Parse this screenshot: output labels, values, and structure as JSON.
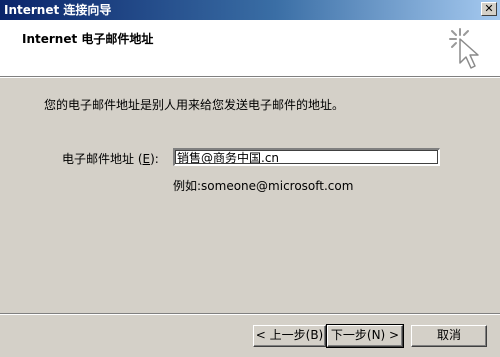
{
  "window": {
    "title": "Internet 连接向导",
    "close_glyph": "✕"
  },
  "header": {
    "title": "Internet 电子邮件地址",
    "icon": "wizard-cursor-icon"
  },
  "main": {
    "intro_text": "您的电子邮件地址是别人用来给您发送电子邮件的地址。",
    "email_label": "电子邮件地址",
    "email_label_hotkey_open": " (",
    "email_label_hotkey": "E",
    "email_label_hotkey_close": "):",
    "email_value": "销售@商务中国.cn",
    "example_text": "例如:someone@microsoft.com"
  },
  "buttons": {
    "back_label": "< 上一步(B)",
    "next_label": "下一步(N) >",
    "cancel_label": "取消"
  }
}
